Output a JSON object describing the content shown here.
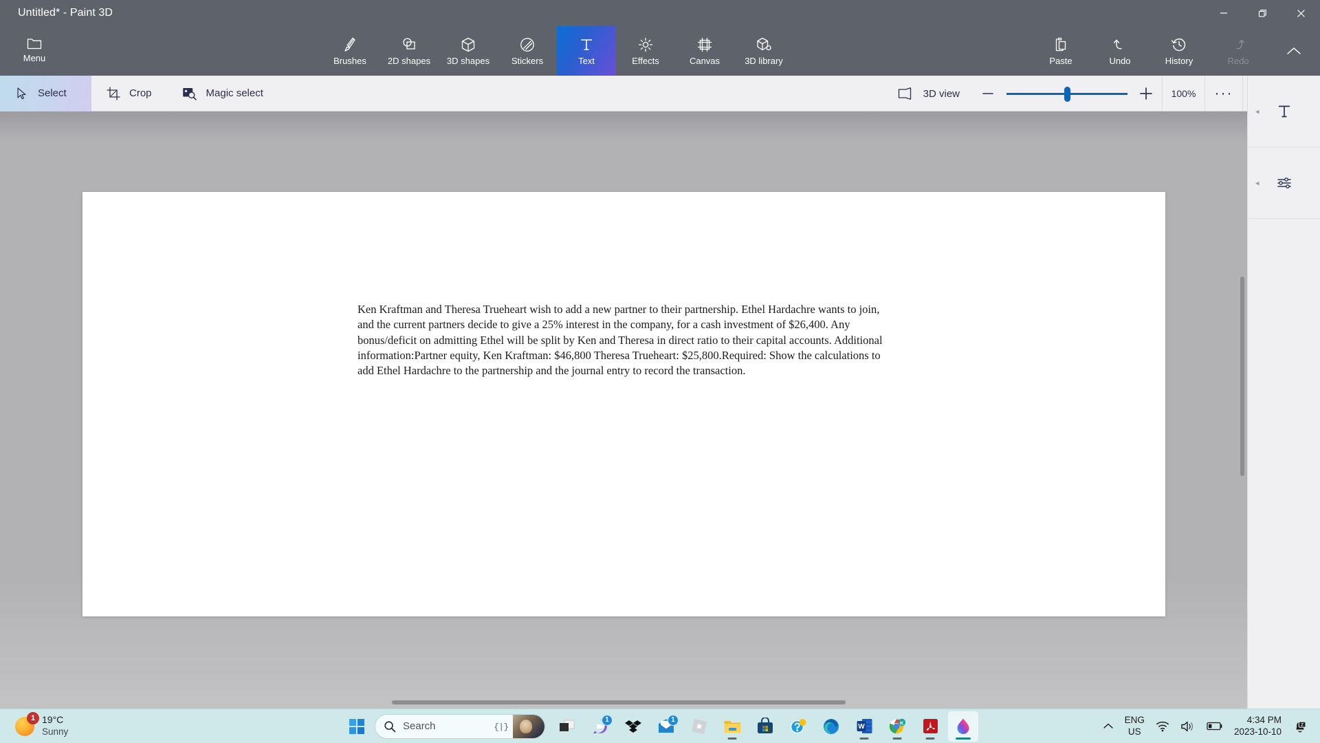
{
  "window": {
    "title": "Untitled* - Paint 3D",
    "controls": [
      {
        "name": "minimize",
        "glyph": "minimize-icon"
      },
      {
        "name": "maximize",
        "glyph": "maximize-icon"
      },
      {
        "name": "close",
        "glyph": "close-icon"
      }
    ]
  },
  "ribbon": {
    "menu_label": "Menu",
    "tools": [
      {
        "label": "Brushes",
        "icon": "brush-icon",
        "active": false
      },
      {
        "label": "2D shapes",
        "icon": "2d-shapes-icon",
        "active": false
      },
      {
        "label": "3D shapes",
        "icon": "3d-shapes-icon",
        "active": false
      },
      {
        "label": "Stickers",
        "icon": "stickers-icon",
        "active": false
      },
      {
        "label": "Text",
        "icon": "text-icon",
        "active": true
      },
      {
        "label": "Effects",
        "icon": "effects-icon",
        "active": false
      },
      {
        "label": "Canvas",
        "icon": "canvas-icon",
        "active": false
      },
      {
        "label": "3D library",
        "icon": "3d-library-icon",
        "active": false
      }
    ],
    "actions": [
      {
        "label": "Paste",
        "icon": "paste-icon",
        "disabled": false
      },
      {
        "label": "Undo",
        "icon": "undo-icon",
        "disabled": false
      },
      {
        "label": "History",
        "icon": "history-icon",
        "disabled": false
      },
      {
        "label": "Redo",
        "icon": "redo-icon",
        "disabled": true
      }
    ],
    "collapse_icon": "chevron-up-icon"
  },
  "subtoolbar": {
    "select_label": "Select",
    "crop_label": "Crop",
    "magic_select_label": "Magic select",
    "view3d_label": "3D view",
    "zoom_out_label": "—",
    "zoom_in_label": "+",
    "zoom_value": "100%",
    "more_label": "···",
    "zoom_percent": 100
  },
  "right_panel": {
    "items": [
      {
        "name": "text-panel",
        "icon": "text-T-icon"
      },
      {
        "name": "adjustments-panel",
        "icon": "sliders-icon"
      }
    ]
  },
  "canvas": {
    "text": "Ken Kraftman and Theresa Trueheart wish to add a new partner to their partnership. Ethel Hardachre wants to join, and the current partners decide to give a 25% interest in the company, for a cash investment of $26,400. Any bonus/deficit on admitting Ethel will be split by Ken and Theresa in direct ratio to their capital accounts. Additional information:Partner equity, Ken Kraftman: $46,800 Theresa Trueheart: $25,800.Required: Show the calculations to add Ethel Hardachre to the partnership and the journal entry to record the transaction."
  },
  "taskbar": {
    "weather": {
      "temperature": "19°C",
      "condition": "Sunny",
      "badge": "1"
    },
    "start_label": "start-button",
    "search": {
      "placeholder": "Search"
    },
    "apps": [
      {
        "name": "task-view",
        "icon": "task-view-icon",
        "badge": "",
        "running": false,
        "active": false
      },
      {
        "name": "chat",
        "icon": "chat-icon",
        "badge": "1",
        "running": false,
        "active": false
      },
      {
        "name": "dropbox",
        "icon": "dropbox-icon",
        "badge": "",
        "running": false,
        "active": false
      },
      {
        "name": "mail",
        "icon": "mail-icon",
        "badge": "1",
        "running": false,
        "active": false
      },
      {
        "name": "roblox",
        "icon": "roblox-icon",
        "badge": "",
        "running": false,
        "active": false
      },
      {
        "name": "file-explorer",
        "icon": "folder-icon",
        "badge": "",
        "running": true,
        "active": false
      },
      {
        "name": "microsoft-store",
        "icon": "store-icon",
        "badge": "",
        "running": false,
        "active": false
      },
      {
        "name": "get-help",
        "icon": "help-icon",
        "badge": "",
        "running": false,
        "active": false
      },
      {
        "name": "microsoft-edge",
        "icon": "edge-icon",
        "badge": "",
        "running": false,
        "active": false
      },
      {
        "name": "microsoft-word",
        "icon": "word-icon",
        "badge": "",
        "running": true,
        "active": false
      },
      {
        "name": "google-chrome",
        "icon": "chrome-icon",
        "badge": "",
        "running": true,
        "active": false
      },
      {
        "name": "adobe-acrobat",
        "icon": "acrobat-icon",
        "badge": "",
        "running": true,
        "active": false
      },
      {
        "name": "paint-3d",
        "icon": "paint3d-icon",
        "badge": "",
        "running": true,
        "active": true
      }
    ],
    "tray": {
      "overflow_icon": "chevron-up-icon",
      "language_line1": "ENG",
      "language_line2": "US",
      "network_icon": "wifi-icon",
      "volume_icon": "speaker-icon",
      "battery_icon": "battery-icon",
      "time": "4:34 PM",
      "date": "2023-10-10",
      "notification_icon": "bell-dnd-icon"
    }
  },
  "colors": {
    "titlebar": "#5e626b",
    "accent_blue": "#0d63ba",
    "active_tab_gradient_start": "#0b6fd4",
    "active_tab_gradient_end": "#6a4fd8",
    "taskbar": "#cfe8ea",
    "canvas_bg": "#b2b2b4"
  }
}
